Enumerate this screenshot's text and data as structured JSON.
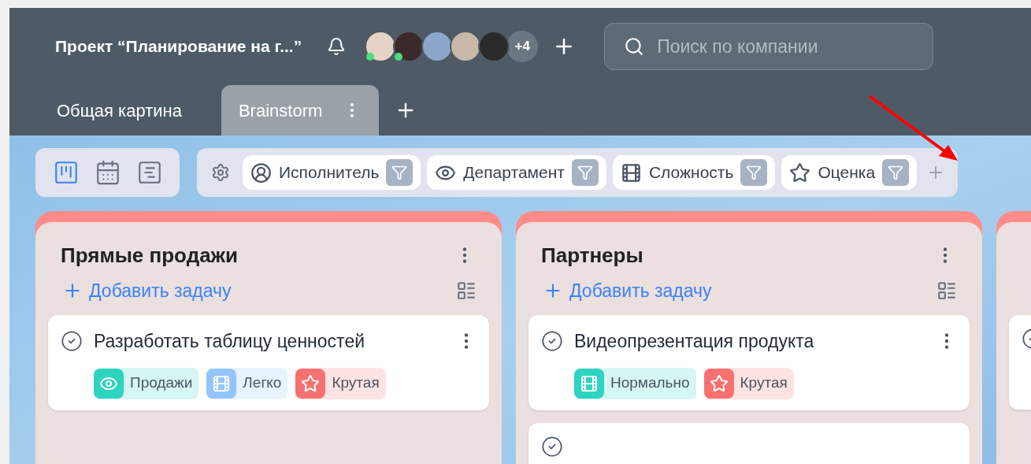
{
  "header": {
    "title": "Проект “Планирование на г...”",
    "avatars": [
      {
        "online": true
      },
      {
        "online": true
      },
      {
        "online": false
      },
      {
        "online": false
      },
      {
        "online": false
      }
    ],
    "more_count": "+4",
    "search": {
      "placeholder": "Поиск по компании"
    }
  },
  "tabs": [
    {
      "label": "Общая картина",
      "selected": false
    },
    {
      "label": "Brainstorm",
      "selected": true
    }
  ],
  "views": [
    {
      "kind": "board",
      "selected": true
    },
    {
      "kind": "calendar",
      "selected": false
    },
    {
      "kind": "timeline",
      "selected": false
    }
  ],
  "filters": [
    {
      "kind": "person",
      "label": "Исполнитель"
    },
    {
      "kind": "eye",
      "label": "Департамент"
    },
    {
      "kind": "film",
      "label": "Сложность"
    },
    {
      "kind": "star",
      "label": "Оценка"
    }
  ],
  "columns": [
    {
      "title": "Прямые продажи",
      "add_label": "Добавить задачу",
      "cards": [
        {
          "title": "Разработать таблицу ценностей",
          "tags": [
            {
              "kind": "eye",
              "label": "Продажи",
              "color": "#2dd4bf"
            },
            {
              "kind": "film",
              "label": "Легко",
              "color": "#93c5fd"
            },
            {
              "kind": "star",
              "label": "Крутая",
              "color": "#f87171"
            }
          ]
        }
      ]
    },
    {
      "title": "Партнеры",
      "add_label": "Добавить задачу",
      "cards": [
        {
          "title": "Видеопрезентация продукта",
          "tags": [
            {
              "kind": "film",
              "label": "Нормально",
              "color": "#2dd4bf"
            },
            {
              "kind": "star",
              "label": "Крутая",
              "color": "#f87171"
            }
          ]
        },
        {
          "kind": "cut_off"
        }
      ]
    },
    {
      "cards": [
        {
          "kind": "cut_off"
        }
      ]
    }
  ]
}
